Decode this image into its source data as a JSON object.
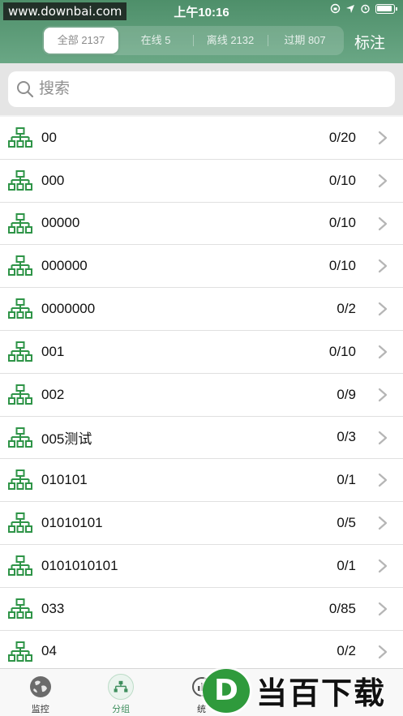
{
  "watermark": "www.downbai.com",
  "status_bar": {
    "time": "上午10:16"
  },
  "segments": [
    {
      "label": "全部 2137",
      "active": true
    },
    {
      "label": "在线 5",
      "active": false
    },
    {
      "label": "离线 2132",
      "active": false
    },
    {
      "label": "过期 807",
      "active": false
    }
  ],
  "header": {
    "mark_label": "标注"
  },
  "search": {
    "placeholder": "搜索"
  },
  "groups": [
    {
      "name": "00",
      "count": "0/20"
    },
    {
      "name": "000",
      "count": "0/10"
    },
    {
      "name": "00000",
      "count": "0/10"
    },
    {
      "name": "000000",
      "count": "0/10"
    },
    {
      "name": "0000000",
      "count": "0/2"
    },
    {
      "name": "001",
      "count": "0/10"
    },
    {
      "name": "002",
      "count": "0/9"
    },
    {
      "name": "005测试",
      "count": "0/3"
    },
    {
      "name": "010101",
      "count": "0/1"
    },
    {
      "name": "01010101",
      "count": "0/5"
    },
    {
      "name": "0101010101",
      "count": "0/1"
    },
    {
      "name": "033",
      "count": "0/85"
    },
    {
      "name": "04",
      "count": "0/2"
    }
  ],
  "tabs": [
    {
      "label": "监控",
      "icon": "globe-icon",
      "active": false
    },
    {
      "label": "分组",
      "icon": "org-chart-icon",
      "active": true
    },
    {
      "label": "统",
      "icon": "stats-icon",
      "active": false
    },
    {
      "label": "",
      "icon": "",
      "active": false
    },
    {
      "label": "",
      "icon": "",
      "active": false
    }
  ],
  "brand_overlay": {
    "logo_letter": "D",
    "text": "当百下载"
  },
  "colors": {
    "header": "#5a9b76",
    "accent": "#3f8f5e",
    "icon_green": "#2e9447"
  }
}
